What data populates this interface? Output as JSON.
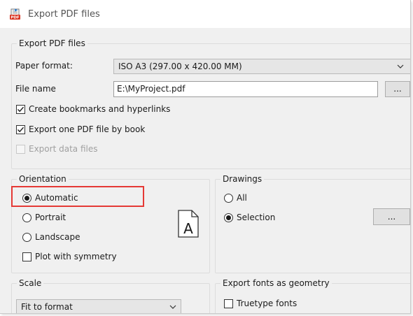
{
  "window": {
    "title": "Export PDF files",
    "icon": "pdf-export-icon"
  },
  "export_group": {
    "legend": "Export PDF files",
    "paper_format_label": "Paper format:",
    "paper_format_value": "ISO A3 (297.00 x 420.00 MM)",
    "file_name_label": "File name",
    "file_name_value": "E:\\MyProject.pdf",
    "browse_label": "...",
    "bookmarks_label": "Create bookmarks and hyperlinks",
    "bookmarks_checked": true,
    "one_pdf_label": "Export one PDF file by book",
    "one_pdf_checked": true,
    "data_files_label": "Export data files",
    "data_files_checked": false,
    "data_files_enabled": false
  },
  "orientation": {
    "legend": "Orientation",
    "options": [
      "Automatic",
      "Portrait",
      "Landscape"
    ],
    "selected": "Automatic",
    "symmetry_label": "Plot with symmetry",
    "symmetry_checked": false,
    "preview_icon": "page-orientation-icon",
    "highlight_color": "#e53935"
  },
  "drawings": {
    "legend": "Drawings",
    "options": [
      "All",
      "Selection"
    ],
    "selected": "Selection",
    "browse_label": "..."
  },
  "scale": {
    "legend": "Scale",
    "value": "Fit to format"
  },
  "fonts": {
    "legend": "Export fonts as geometry",
    "truetype_label": "Truetype fonts",
    "truetype_checked": false
  }
}
